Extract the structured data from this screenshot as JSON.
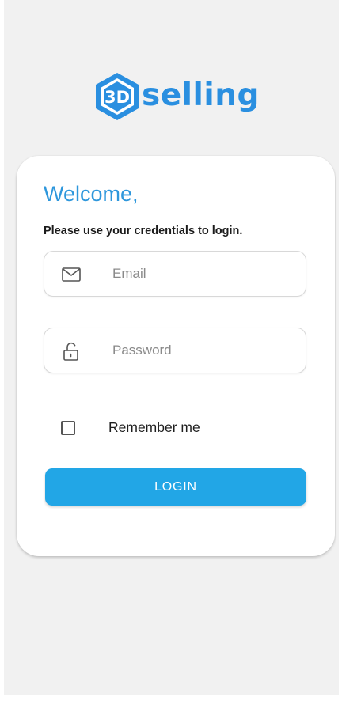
{
  "brand": {
    "mark_text": "3D",
    "wordmark": "selling",
    "color": "#2a8fe0"
  },
  "card": {
    "welcome": "Welcome,",
    "subtitle": "Please use your credentials to login."
  },
  "email_field": {
    "placeholder": "Email",
    "value": "",
    "icon": "envelope-icon"
  },
  "password_field": {
    "placeholder": "Password",
    "value": "",
    "icon": "unlock-icon"
  },
  "remember_me": {
    "label": "Remember me",
    "checked": false
  },
  "login_button": {
    "label": "LOGIN",
    "color": "#22a6e6"
  },
  "colors": {
    "background": "#f1f1f1",
    "accent": "#2e97dc"
  }
}
